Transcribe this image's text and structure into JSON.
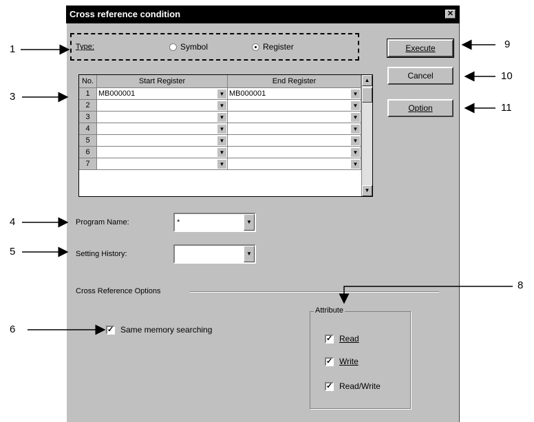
{
  "dialog": {
    "title": "Cross reference condition",
    "close_glyph": "✕"
  },
  "type_group": {
    "label": "Type:",
    "options": [
      {
        "label": "Symbol",
        "selected": false
      },
      {
        "label": "Register",
        "selected": true
      }
    ]
  },
  "buttons": {
    "execute": "Execute",
    "cancel": "Cancel",
    "option": "Option"
  },
  "grid": {
    "headers": [
      "No.",
      "Start Register",
      "End Register"
    ],
    "rows": [
      {
        "no": "1",
        "start": "MB000001",
        "end": "MB000001"
      },
      {
        "no": "2",
        "start": "",
        "end": ""
      },
      {
        "no": "3",
        "start": "",
        "end": ""
      },
      {
        "no": "4",
        "start": "",
        "end": ""
      },
      {
        "no": "5",
        "start": "",
        "end": ""
      },
      {
        "no": "6",
        "start": "",
        "end": ""
      },
      {
        "no": "7",
        "start": "",
        "end": ""
      }
    ]
  },
  "program_name": {
    "label": "Program Name:",
    "value": "*"
  },
  "setting_history": {
    "label": "Setting History:",
    "value": ""
  },
  "cross_reference_options": {
    "label": "Cross Reference Options"
  },
  "same_memory": {
    "label": "Same memory searching",
    "checked": true
  },
  "attribute": {
    "title": "Attribute",
    "items": [
      {
        "label": "Read",
        "checked": true
      },
      {
        "label": "Write",
        "checked": true
      },
      {
        "label": "Read/Write",
        "checked": true
      }
    ]
  },
  "callouts": [
    "1",
    "3",
    "4",
    "5",
    "6",
    "8",
    "9",
    "10",
    "11"
  ],
  "icons": {
    "dropdown": "▼",
    "scroll_up": "▲",
    "scroll_down": "▼",
    "check": "✓"
  }
}
